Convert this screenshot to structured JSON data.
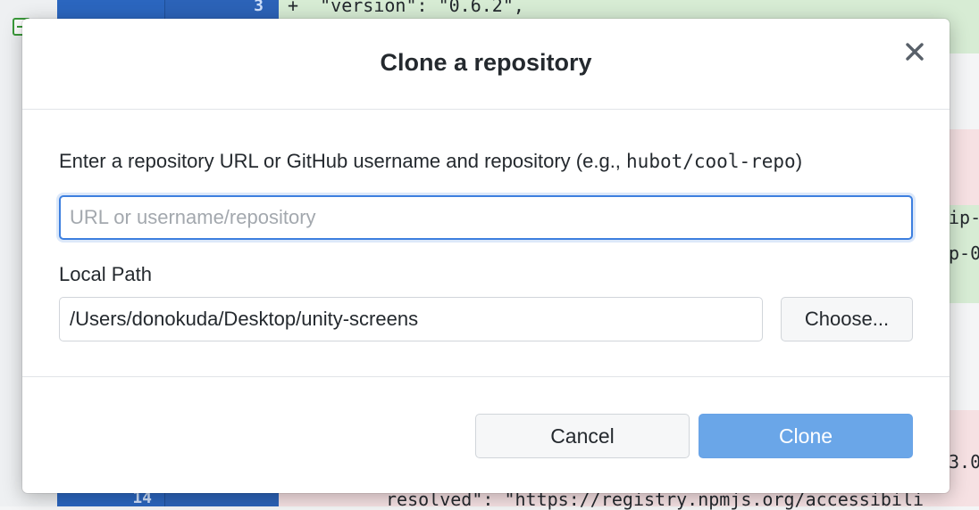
{
  "background": {
    "line_numbers": [
      "3",
      "14"
    ],
    "code_lines": [
      "+  \"version\": \"0.6.2\",",
      "ip-",
      "p-0",
      "3.0",
      "resolved\": \"https://registry.npmjs.org/accessibili"
    ]
  },
  "dialog": {
    "title": "Clone a repository",
    "close_icon": "close-icon",
    "prompt_text": "Enter a repository URL or GitHub username and repository (e.g., ",
    "prompt_example": "hubot/cool-repo",
    "prompt_suffix": ")",
    "url_input": {
      "value": "",
      "placeholder": "URL or username/repository"
    },
    "local_path_label": "Local Path",
    "local_path_value": "/Users/donokuda/Desktop/unity-screens",
    "choose_label": "Choose...",
    "cancel_label": "Cancel",
    "clone_label": "Clone"
  },
  "colors": {
    "accent": "#3d7fdf",
    "clone_button": "#6aa6e8",
    "diff_added": "#d7ecd4",
    "diff_removed": "#f6e1e3",
    "gutter_blue": "#2b66bf"
  }
}
